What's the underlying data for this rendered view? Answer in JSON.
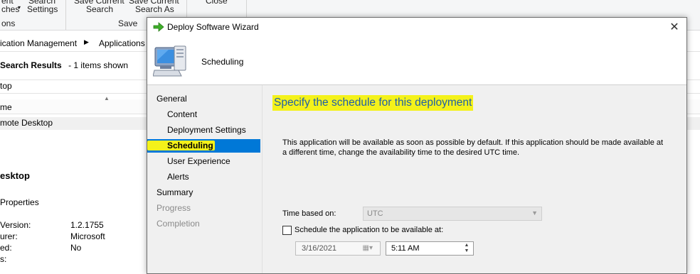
{
  "console": {
    "ribbon": {
      "btn_recent_searches": "ches",
      "btn_recent_searches_top": "ent",
      "btn_search_settings_top": "Search",
      "btn_search_settings": "Settings",
      "group_options": "ons",
      "btn_save_current_search_top": "Save Current",
      "btn_save_current_search": "Search",
      "btn_save_search_as_top": "Save Current",
      "btn_save_search_as": "Search As",
      "group_save": "Save",
      "btn_close": "Close"
    },
    "breadcrumb": [
      "ication Management",
      "Applications"
    ],
    "search_results_label": "Search Results",
    "search_results_count": "-  1 items shown",
    "search_text": "top",
    "column_header": "me",
    "row_text": "mote Desktop",
    "details_title": "esktop",
    "details_tab": "Properties",
    "properties": [
      {
        "label": "Version:",
        "value": "1.2.1755"
      },
      {
        "label": "urer:",
        "value": "Microsoft"
      },
      {
        "label": "ed:",
        "value": "No"
      },
      {
        "label": "s:",
        "value": ""
      }
    ]
  },
  "wizard": {
    "title": "Deploy Software Wizard",
    "close_glyph": "✕",
    "header": "Scheduling",
    "nav": [
      {
        "label": "General",
        "state": "normal"
      },
      {
        "label": "Content",
        "state": "normal"
      },
      {
        "label": "Deployment Settings",
        "state": "normal"
      },
      {
        "label": "Scheduling",
        "state": "selected"
      },
      {
        "label": "User Experience",
        "state": "normal"
      },
      {
        "label": "Alerts",
        "state": "normal"
      },
      {
        "label": "Summary",
        "state": "normal"
      },
      {
        "label": "Progress",
        "state": "disabled"
      },
      {
        "label": "Completion",
        "state": "disabled"
      }
    ],
    "content": {
      "heading": "Specify the schedule for this deployment",
      "description": "This application will be available as soon as possible by default. If this application should be made available at a different time, change the availability time to the desired UTC time.",
      "time_based_label": "Time based on:",
      "time_based_value": "UTC",
      "schedule_checkbox_label": "Schedule the application to be available at:",
      "schedule_checked": false,
      "date_value": "3/16/2021",
      "time_value": "5:11 AM"
    },
    "colors": {
      "selection": "#0078d7",
      "highlight": "#f4f21a",
      "heading": "#1f5fa8"
    }
  }
}
